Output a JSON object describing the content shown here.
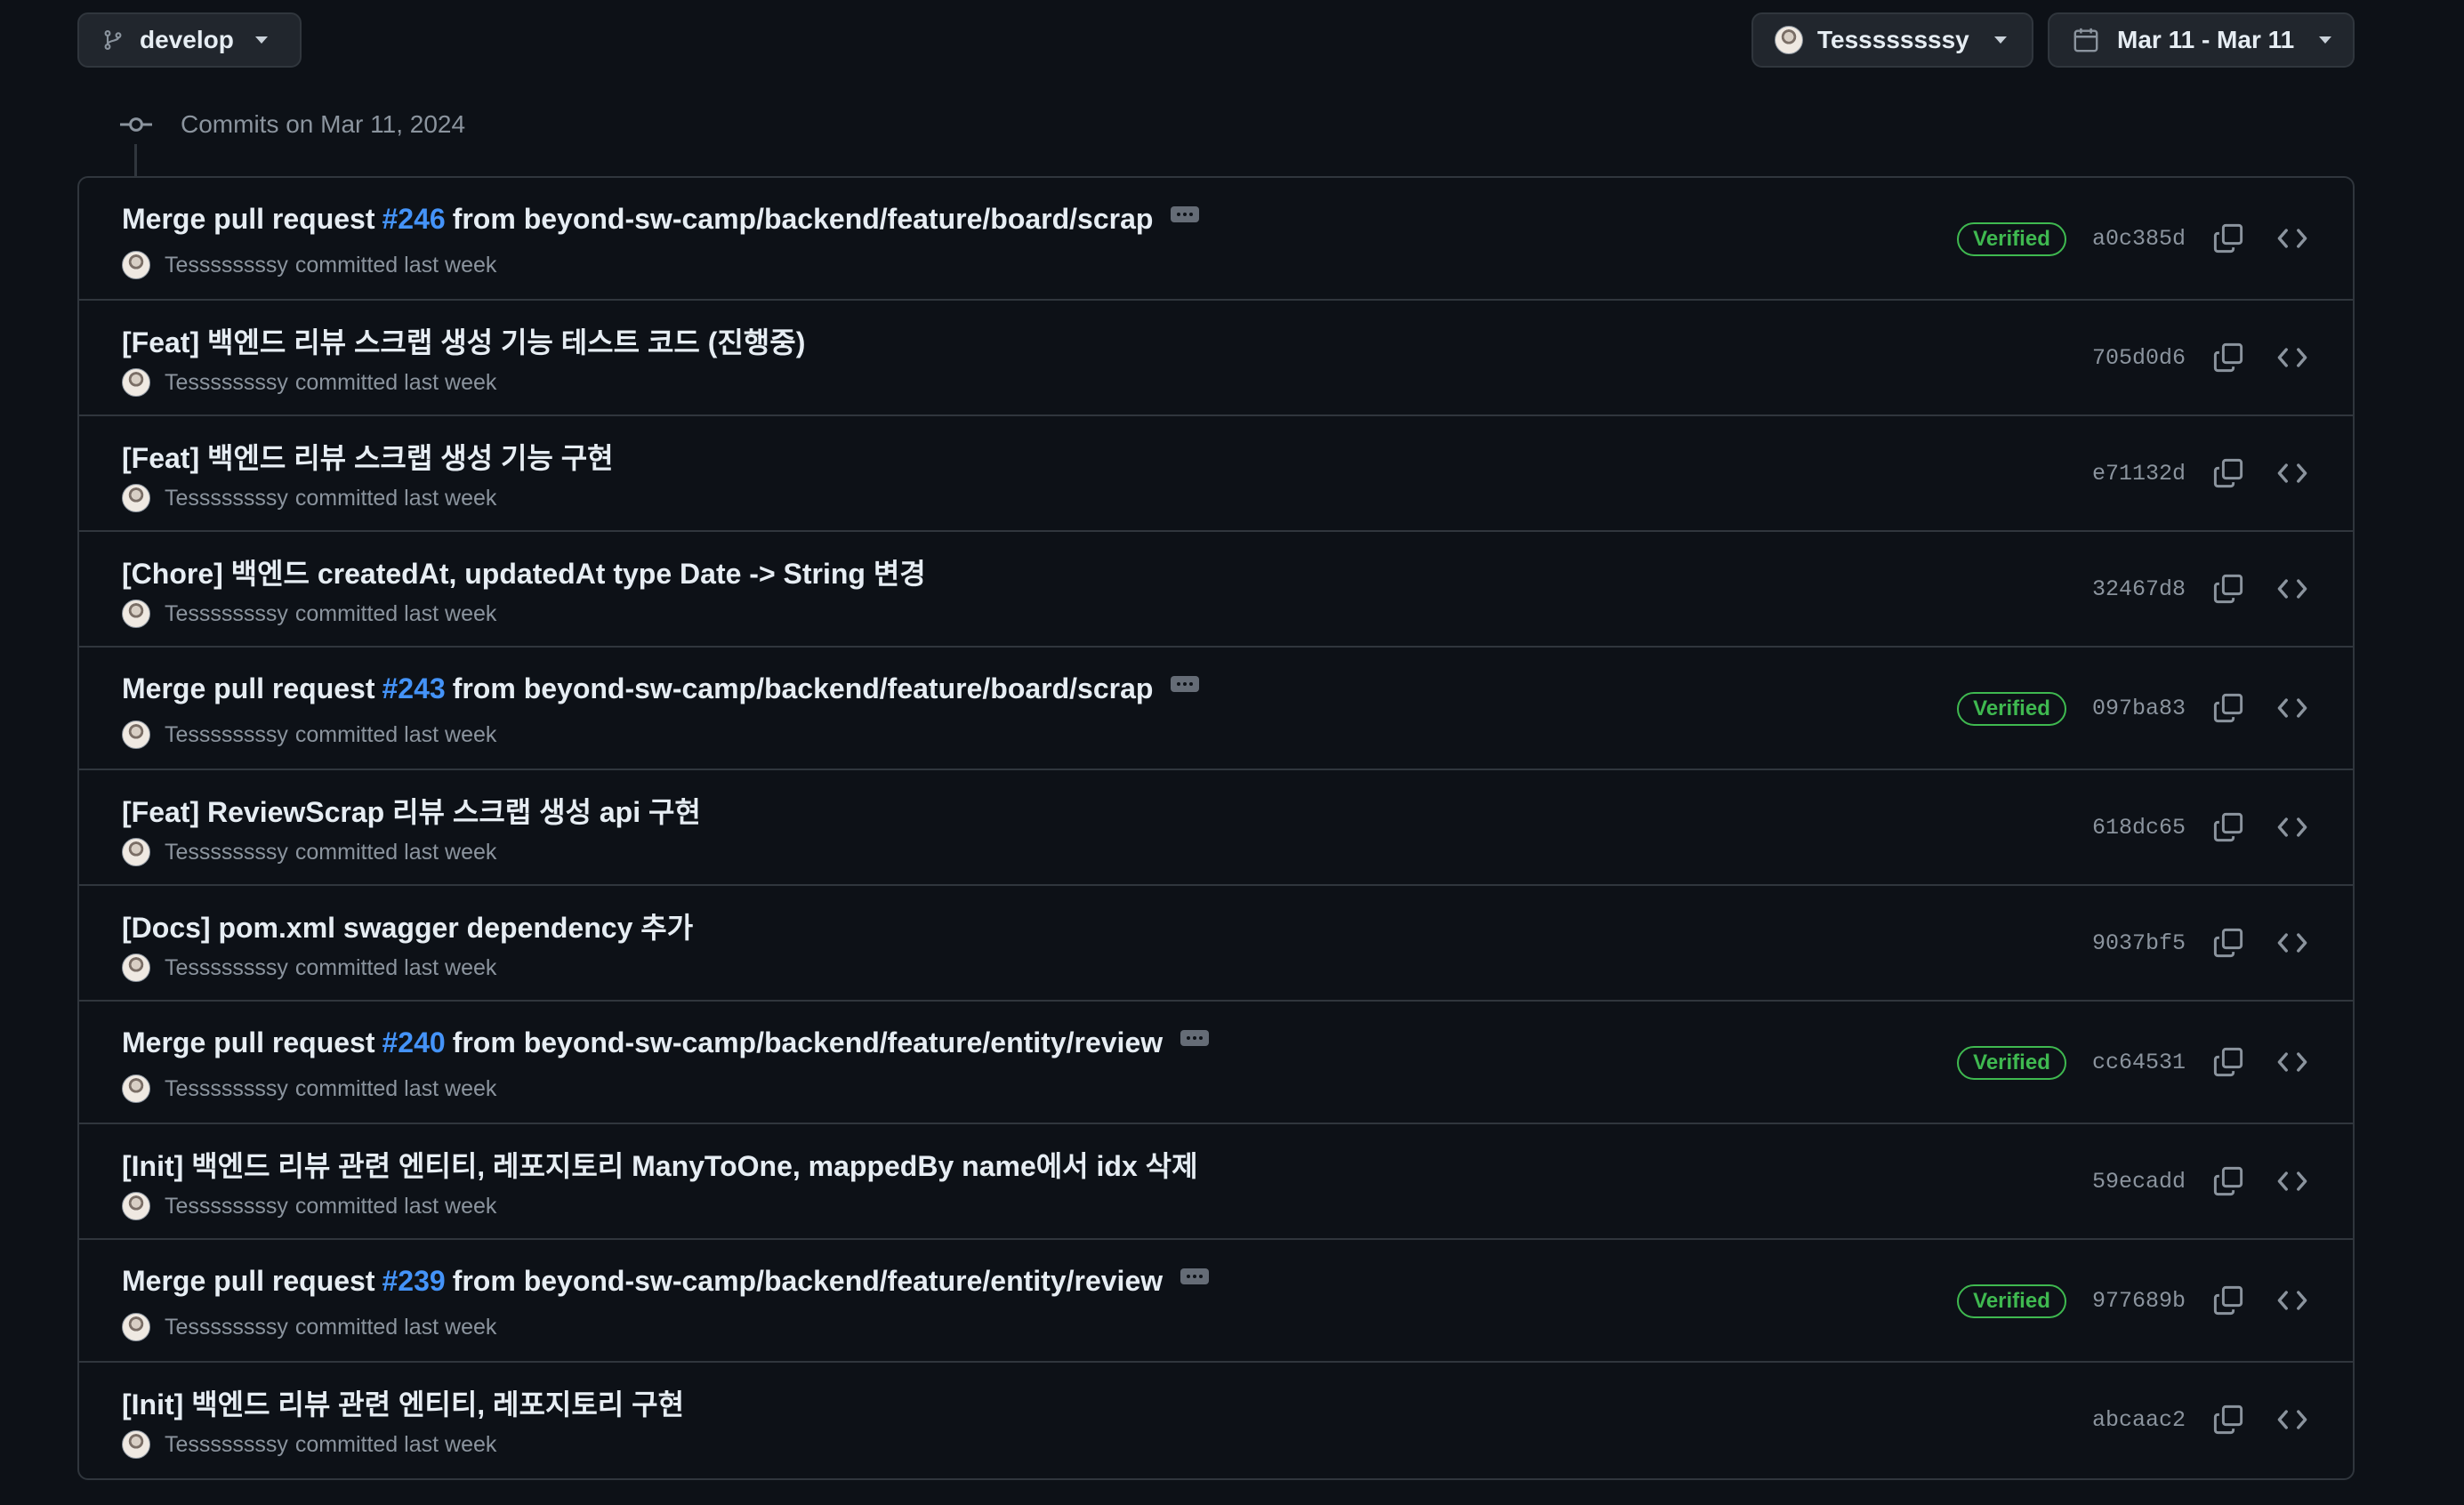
{
  "toolbar": {
    "branch_label": "develop",
    "author_label": "Tessssssssy",
    "date_label": "Mar 11 - Mar 11"
  },
  "commits_header": "Commits on Mar 11, 2024",
  "commits": [
    {
      "prefix": "Merge pull request",
      "pr": "#246",
      "suffix": "from beyond-sw-camp/backend/feature/board/scrap",
      "author": "Tessssssssy",
      "meta": "committed last week",
      "verified": "Verified",
      "sha": "a0c385d"
    },
    {
      "title": "[Feat] 백엔드 리뷰 스크랩 생성 기능 테스트 코드 (진행중)",
      "author": "Tessssssssy",
      "meta": "committed last week",
      "sha": "705d0d6"
    },
    {
      "title": "[Feat] 백엔드 리뷰 스크랩 생성 기능 구현",
      "author": "Tessssssssy",
      "meta": "committed last week",
      "sha": "e71132d"
    },
    {
      "title": "[Chore] 백엔드 createdAt, updatedAt type Date -> String 변경",
      "author": "Tessssssssy",
      "meta": "committed last week",
      "sha": "32467d8"
    },
    {
      "prefix": "Merge pull request",
      "pr": "#243",
      "suffix": "from beyond-sw-camp/backend/feature/board/scrap",
      "author": "Tessssssssy",
      "meta": "committed last week",
      "verified": "Verified",
      "sha": "097ba83"
    },
    {
      "title": "[Feat] ReviewScrap 리뷰 스크랩 생성 api 구현",
      "author": "Tessssssssy",
      "meta": "committed last week",
      "sha": "618dc65"
    },
    {
      "title": "[Docs] pom.xml swagger dependency 추가",
      "author": "Tessssssssy",
      "meta": "committed last week",
      "sha": "9037bf5"
    },
    {
      "prefix": "Merge pull request",
      "pr": "#240",
      "suffix": "from beyond-sw-camp/backend/feature/entity/review",
      "author": "Tessssssssy",
      "meta": "committed last week",
      "verified": "Verified",
      "sha": "cc64531"
    },
    {
      "title": "[Init] 백엔드 리뷰 관련 엔티티, 레포지토리 ManyToOne, mappedBy name에서 idx 삭제",
      "author": "Tessssssssy",
      "meta": "committed last week",
      "sha": "59ecadd"
    },
    {
      "prefix": "Merge pull request",
      "pr": "#239",
      "suffix": "from beyond-sw-camp/backend/feature/entity/review",
      "author": "Tessssssssy",
      "meta": "committed last week",
      "verified": "Verified",
      "sha": "977689b"
    },
    {
      "title": "[Init] 백엔드 리뷰 관련 엔티티, 레포지토리 구현",
      "author": "Tessssssssy",
      "meta": "committed last week",
      "sha": "abcaac2"
    }
  ],
  "icons": {
    "branch": "git-branch-icon",
    "avatar": "user-avatar",
    "calendar": "calendar-icon",
    "commit": "git-commit-icon",
    "copy": "copy-icon",
    "browse": "code-icon",
    "ellipsis": "ellipsis-icon"
  },
  "colors": {
    "background": "#0d1117",
    "border": "#30363d",
    "text": "#e6edf3",
    "muted": "#8b949e",
    "link": "#4493f8",
    "verified": "#3fb950"
  }
}
